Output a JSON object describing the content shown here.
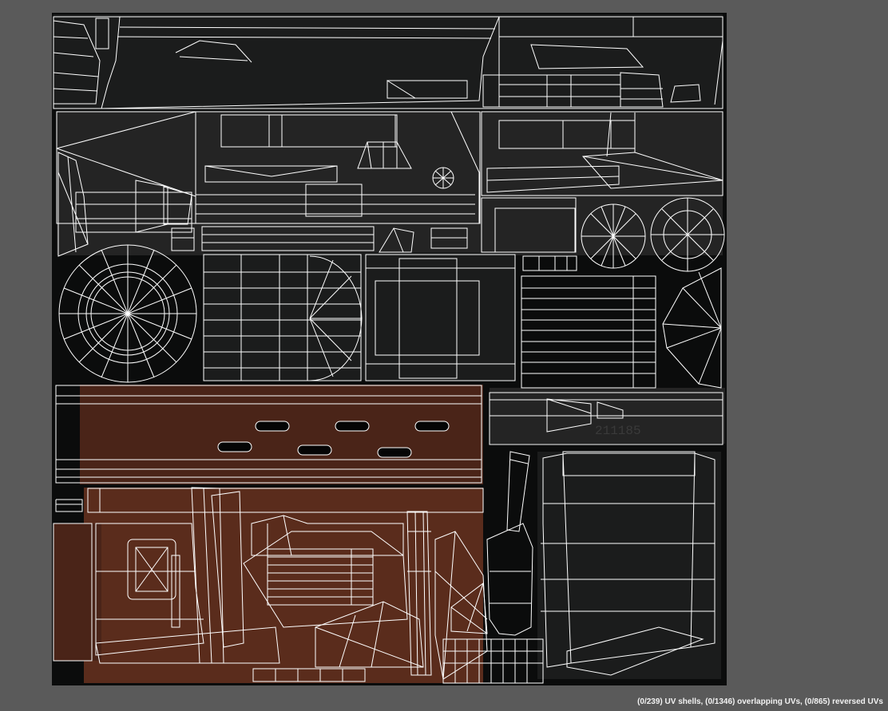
{
  "viewport": {
    "background_color": "#5a5a5a",
    "canvas_color": "#0b0c0c",
    "wire_color": "#ffffff"
  },
  "texture": {
    "stamped_text": "211185"
  },
  "status": {
    "text": "(0/239) UV shells, (0/1346) overlapping UVs, (0/865) reversed UVs"
  }
}
